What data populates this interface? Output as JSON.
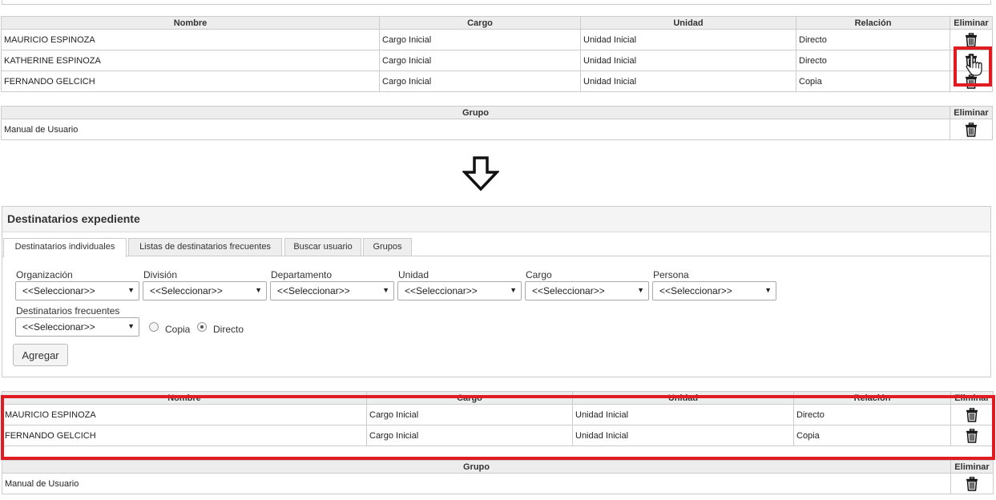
{
  "table_headers": {
    "nombre": "Nombre",
    "cargo": "Cargo",
    "unidad": "Unidad",
    "relacion": "Relación",
    "eliminar": "Eliminar",
    "grupo": "Grupo"
  },
  "top_recipients": [
    {
      "nombre": "MAURICIO ESPINOZA",
      "cargo": "Cargo Inicial",
      "unidad": "Unidad Inicial",
      "relacion": "Directo"
    },
    {
      "nombre": "KATHERINE ESPINOZA",
      "cargo": "Cargo Inicial",
      "unidad": "Unidad Inicial",
      "relacion": "Directo"
    },
    {
      "nombre": "FERNANDO GELCICH",
      "cargo": "Cargo Inicial",
      "unidad": "Unidad Inicial",
      "relacion": "Copia"
    }
  ],
  "top_groups": [
    {
      "grupo": "Manual de Usuario"
    }
  ],
  "panel": {
    "title": "Destinatarios expediente",
    "tabs": [
      "Destinatarios individuales",
      "Listas de destinatarios frecuentes",
      "Buscar usuario",
      "Grupos"
    ],
    "fields": {
      "organizacion": {
        "label": "Organización",
        "value": "<<Seleccionar>>"
      },
      "division": {
        "label": "División",
        "value": "<<Seleccionar>>"
      },
      "departamento": {
        "label": "Departamento",
        "value": "<<Seleccionar>>"
      },
      "unidad": {
        "label": "Unidad",
        "value": "<<Seleccionar>>"
      },
      "cargo": {
        "label": "Cargo",
        "value": "<<Seleccionar>>"
      },
      "persona": {
        "label": "Persona",
        "value": "<<Seleccionar>>"
      },
      "frecuentes": {
        "label": "Destinatarios frecuentes",
        "value": "<<Seleccionar>>"
      }
    },
    "radio_copia": "Copia",
    "radio_directo": "Directo",
    "radio_selected": "Directo",
    "add_button": "Agregar"
  },
  "bottom_recipients": [
    {
      "nombre": "MAURICIO ESPINOZA",
      "cargo": "Cargo Inicial",
      "unidad": "Unidad Inicial",
      "relacion": "Directo"
    },
    {
      "nombre": "FERNANDO GELCICH",
      "cargo": "Cargo Inicial",
      "unidad": "Unidad Inicial",
      "relacion": "Copia"
    }
  ],
  "bottom_groups": [
    {
      "grupo": "Manual de Usuario"
    }
  ],
  "colors": {
    "highlight": "#e01b22",
    "header_bg": "#ededed",
    "border": "#cccccc"
  },
  "icons": {
    "delete": "trash-icon",
    "arrow": "arrow-down-icon",
    "cursor": "hand-pointer-icon"
  }
}
